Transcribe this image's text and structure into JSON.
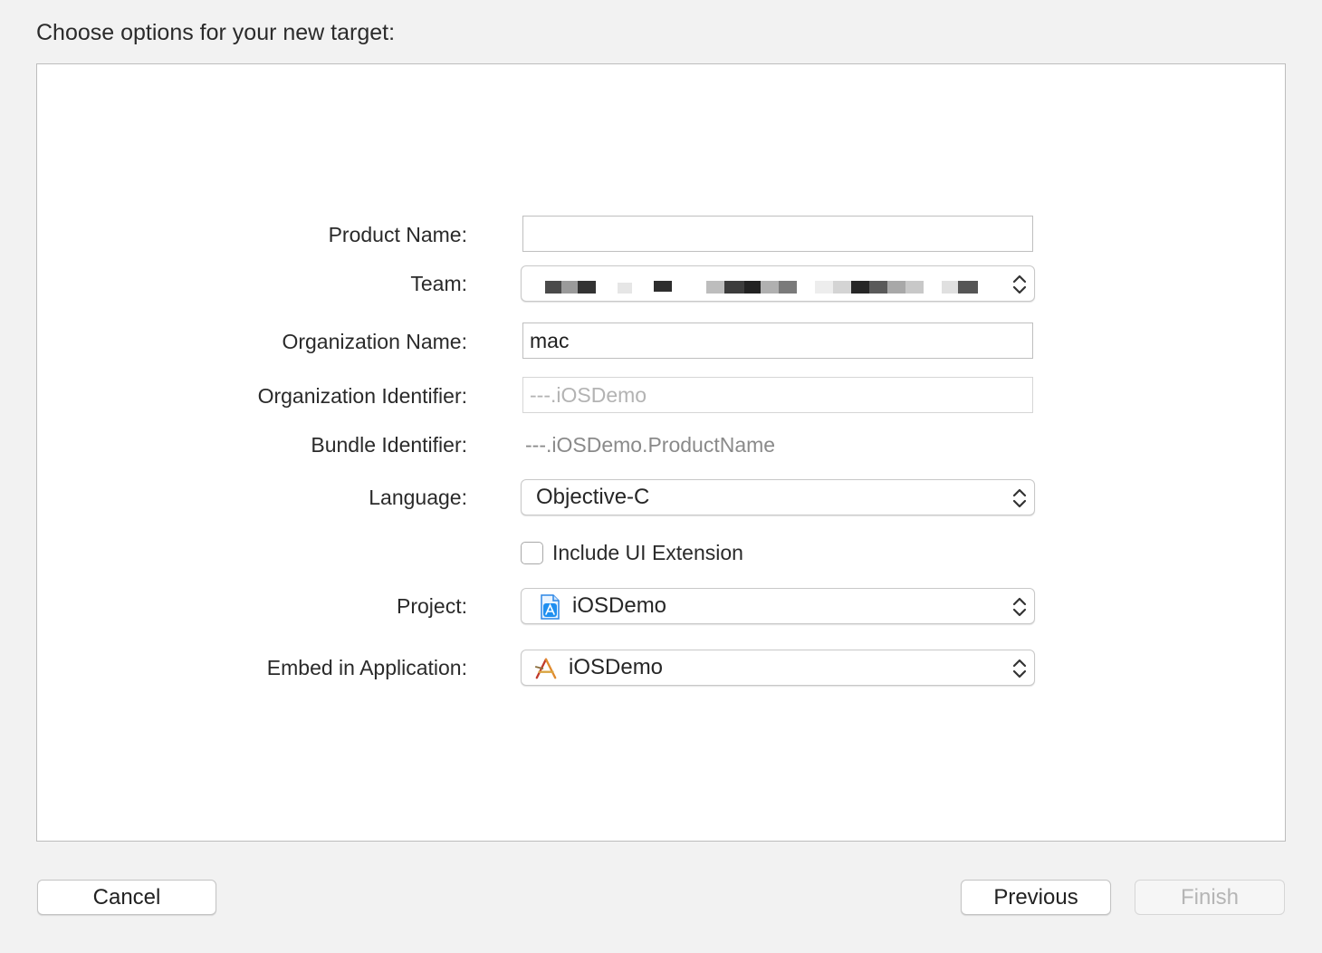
{
  "header": {
    "title": "Choose options for your new target:"
  },
  "form": {
    "product_name": {
      "label": "Product Name:",
      "value": ""
    },
    "team": {
      "label": "Team:"
    },
    "organization_name": {
      "label": "Organization Name:",
      "value": "mac"
    },
    "organization_identifier": {
      "label": "Organization Identifier:",
      "placeholder": "---.iOSDemo"
    },
    "bundle_identifier": {
      "label": "Bundle Identifier:",
      "value": "---.iOSDemo.ProductName"
    },
    "language": {
      "label": "Language:",
      "value": "Objective-C"
    },
    "include_ui_extension": {
      "label": "Include UI Extension",
      "checked": false
    },
    "project": {
      "label": "Project:",
      "value": "iOSDemo",
      "icon": "xcode-project-icon"
    },
    "embed_in_application": {
      "label": "Embed in Application:",
      "value": "iOSDemo",
      "icon": "app-icon"
    }
  },
  "buttons": {
    "cancel": "Cancel",
    "previous": "Previous",
    "finish": "Finish"
  },
  "colors": {
    "window_background": "#f2f2f2",
    "panel_background": "#ffffff",
    "disabled_text": "#b5b5b5",
    "project_icon_blue": "#1f8ff0",
    "app_icon_orange": "#e08a2c"
  }
}
